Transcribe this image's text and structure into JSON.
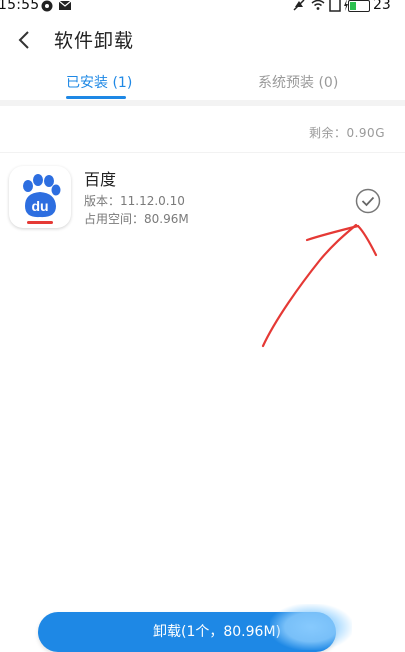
{
  "status_bar": {
    "time": "15:55",
    "battery": "23"
  },
  "header": {
    "title": "软件卸载"
  },
  "tabs": [
    {
      "label": "已安装 (1)",
      "active": true
    },
    {
      "label": "系统预装 (0)",
      "active": false
    }
  ],
  "storage": {
    "remaining": "剩余：0.90G"
  },
  "apps": [
    {
      "name": "百度",
      "version": "版本：11.12.0.10",
      "size": "占用空间：80.96M",
      "checked": true
    }
  ],
  "uninstall_button": {
    "label": "卸载(1个，80.96M)"
  },
  "colors": {
    "accent": "#1e88e5",
    "annotation": "#e53935"
  },
  "icons": [
    "back-arrow-icon",
    "checkmark-circle-icon",
    "baidu-paw-icon"
  ]
}
